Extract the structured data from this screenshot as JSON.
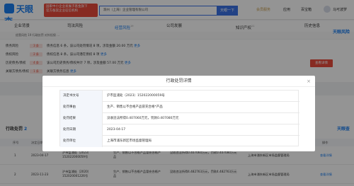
{
  "header": {
    "logo_text": "天眼查",
    "promo_line1": "国家中小企业发展子基金旗下",
    "promo_line2": "官方备案企业征信机构",
    "search_value": "滁州（上海）企业管理有限公司",
    "search_button": "天眼一下",
    "nav": [
      "会员服务",
      "应用",
      "百宝箱",
      "马可波罗"
    ]
  },
  "tabs": [
    {
      "label": "企业背景",
      "count": ""
    },
    {
      "label": "司法风险",
      "count": ""
    },
    {
      "label": "经营风险",
      "count": "19"
    },
    {
      "label": "公司发展",
      "count": ""
    },
    {
      "label": "知识产权",
      "count": "11"
    },
    {
      "label": "历史信息",
      "count": ""
    }
  ],
  "sub_label": "经营风险 19  行政处罚  对外担保  …",
  "brand_right": "天眼风险",
  "risk_rows": [
    {
      "label": "债务风险",
      "pill": "3 条",
      "text": "债务信息 6 条，该公司处罚情况 8 项，涉及金额 20.00 万元",
      "link": "更多"
    },
    {
      "label": "债权风险",
      "pill": "2 条",
      "text": "债权信息 8 条，该公司潜在债权 8 项",
      "link": "更多"
    },
    {
      "label": "历史债务/债权",
      "pill": "4 条",
      "text": "该公司历史债务/债权共计 7 项，涉及金额 57.00 万元",
      "link": "更多"
    },
    {
      "label": "关联方债务/债权",
      "pill": "1 条",
      "text": "关联方债务信息",
      "link": "更多"
    }
  ],
  "risk_button": "查看详情",
  "section": {
    "title": "行政处罚",
    "count": "2",
    "brand": "天眼查"
  },
  "table": {
    "headers": [
      "序号",
      "决定日期",
      "决定文书号",
      "处罚事由",
      "处罚结果",
      "处罚单位",
      "操作"
    ],
    "rows": [
      {
        "index": "1",
        "date": "2023-04-17",
        "doc": "沪市监浦处〔2023〕152022000059号",
        "reason": "生产、销售以不合格产品冒充合格产品",
        "result": "没收违法所得0.407060万元，罚款0.407080万元",
        "unit": "上海市浦东新区市场监督管理局",
        "op": "查看详情"
      },
      {
        "index": "2",
        "date": "2023-11-23",
        "doc": "沪市监浦处〔2020〕152020001226号",
        "reason": "生产、销售以不合格产品冒充合格产品",
        "result": "没收违法所得4.482763万元，罚款4.482763万元",
        "unit": "上海市浦东新区市场监督管理局",
        "op": "查看详情"
      }
    ]
  },
  "modal": {
    "title": "行政处罚详情",
    "close": "×",
    "rows": [
      {
        "key": "决定书文号",
        "value": "沪市监浦处（2023）152022000059号"
      },
      {
        "key": "处罚事由",
        "value": "生产、销售以不合格产品冒充合格*产品"
      },
      {
        "key": "处罚结果",
        "value": "没收违法所得0.407060万元，罚款0.407080万元"
      },
      {
        "key": "处罚日期",
        "value": "2023-04-17"
      },
      {
        "key": "处罚单位",
        "value": "上海市浦东新区市场监督管理局"
      }
    ]
  },
  "colors": {
    "accent": "#1a7ef0",
    "danger": "#e84a3b",
    "overlay": "rgba(0,0,0,0.42)"
  }
}
